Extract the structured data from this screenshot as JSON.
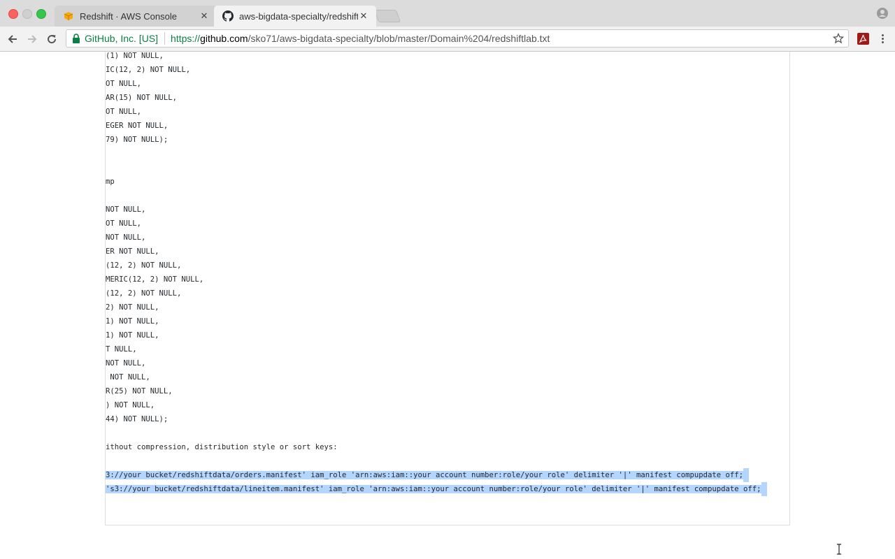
{
  "browser": {
    "tabs": [
      {
        "title": "Redshift · AWS Console",
        "favicon": "aws-cube-icon",
        "active": false
      },
      {
        "title": "aws-bigdata-specialty/redshift",
        "favicon": "github-icon",
        "active": true
      }
    ],
    "close_glyph": "✕",
    "security_label": "GitHub, Inc. [US]",
    "url": {
      "protocol": "https://",
      "host": "github.com",
      "path": "/sko71/aws-bigdata-specialty/blob/master/Domain%204/redshiftlab.txt"
    }
  },
  "file": {
    "lines": [
      {
        "text": "(1) NOT NULL,",
        "selected": false
      },
      {
        "text": "IC(12, 2) NOT NULL,",
        "selected": false
      },
      {
        "text": "OT NULL,",
        "selected": false
      },
      {
        "text": "AR(15) NOT NULL,",
        "selected": false
      },
      {
        "text": "OT NULL,",
        "selected": false
      },
      {
        "text": "EGER NOT NULL,",
        "selected": false
      },
      {
        "text": "79) NOT NULL);",
        "selected": false
      },
      {
        "text": "",
        "selected": false
      },
      {
        "text": "",
        "selected": false
      },
      {
        "text": "mp",
        "selected": false
      },
      {
        "text": "",
        "selected": false
      },
      {
        "text": "NOT NULL,",
        "selected": false
      },
      {
        "text": "OT NULL,",
        "selected": false
      },
      {
        "text": "NOT NULL,",
        "selected": false
      },
      {
        "text": "ER NOT NULL,",
        "selected": false
      },
      {
        "text": "(12, 2) NOT NULL,",
        "selected": false
      },
      {
        "text": "MERIC(12, 2) NOT NULL,",
        "selected": false
      },
      {
        "text": "(12, 2) NOT NULL,",
        "selected": false
      },
      {
        "text": "2) NOT NULL,",
        "selected": false
      },
      {
        "text": "1) NOT NULL,",
        "selected": false
      },
      {
        "text": "1) NOT NULL,",
        "selected": false
      },
      {
        "text": "T NULL,",
        "selected": false
      },
      {
        "text": "NOT NULL,",
        "selected": false
      },
      {
        "text": " NOT NULL,",
        "selected": false
      },
      {
        "text": "R(25) NOT NULL,",
        "selected": false
      },
      {
        "text": ") NOT NULL,",
        "selected": false
      },
      {
        "text": "44) NOT NULL);",
        "selected": false
      },
      {
        "text": "",
        "selected": false
      },
      {
        "text": "ithout compression, distribution style or sort keys:",
        "selected": false
      },
      {
        "text": "",
        "selected": false
      },
      {
        "text": "3://your bucket/redshiftdata/orders.manifest' iam_role 'arn:aws:iam::your account number:role/your role' delimiter '|' manifest compupdate off;",
        "selected": true
      },
      {
        "text": "'s3://your bucket/redshiftdata/lineitem.manifest' iam_role 'arn:aws:iam::your account number:role/your role' delimiter '|' manifest compupdate off;",
        "selected": true
      }
    ]
  },
  "colors": {
    "selection": "#b4d5fe",
    "secure_green": "#0b8043"
  }
}
